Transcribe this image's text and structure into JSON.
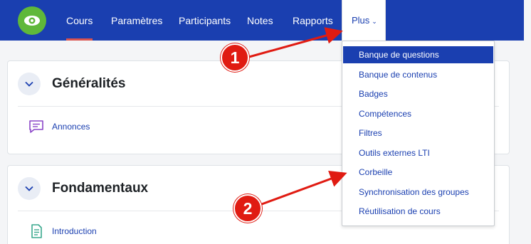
{
  "navbar": {
    "logo_icon": "eye-icon",
    "items": [
      {
        "label": "Cours",
        "active": true
      },
      {
        "label": "Paramètres"
      },
      {
        "label": "Participants"
      },
      {
        "label": "Notes"
      },
      {
        "label": "Rapports"
      }
    ],
    "more": {
      "label": "Plus",
      "icon": "chevron-down-icon"
    }
  },
  "dropdown": {
    "items": [
      "Banque de questions",
      "Banque de contenus",
      "Badges",
      "Compétences",
      "Filtres",
      "Outils externes LTI",
      "Corbeille",
      "Synchronisation des groupes",
      "Réutilisation de cours"
    ],
    "highlighted_index": 0
  },
  "sections": [
    {
      "title": "Généralités",
      "activity": {
        "label": "Annonces",
        "icon": "forum-icon"
      }
    },
    {
      "title": "Fondamentaux",
      "activity": {
        "label": "Introduction",
        "icon": "page-icon"
      }
    }
  ],
  "annotations": [
    "1",
    "2"
  ],
  "colors": {
    "navbar": "#1a3fb0",
    "active_underline": "#d9534f",
    "logo": "#5fb83a",
    "annotation": "#e01b12"
  }
}
